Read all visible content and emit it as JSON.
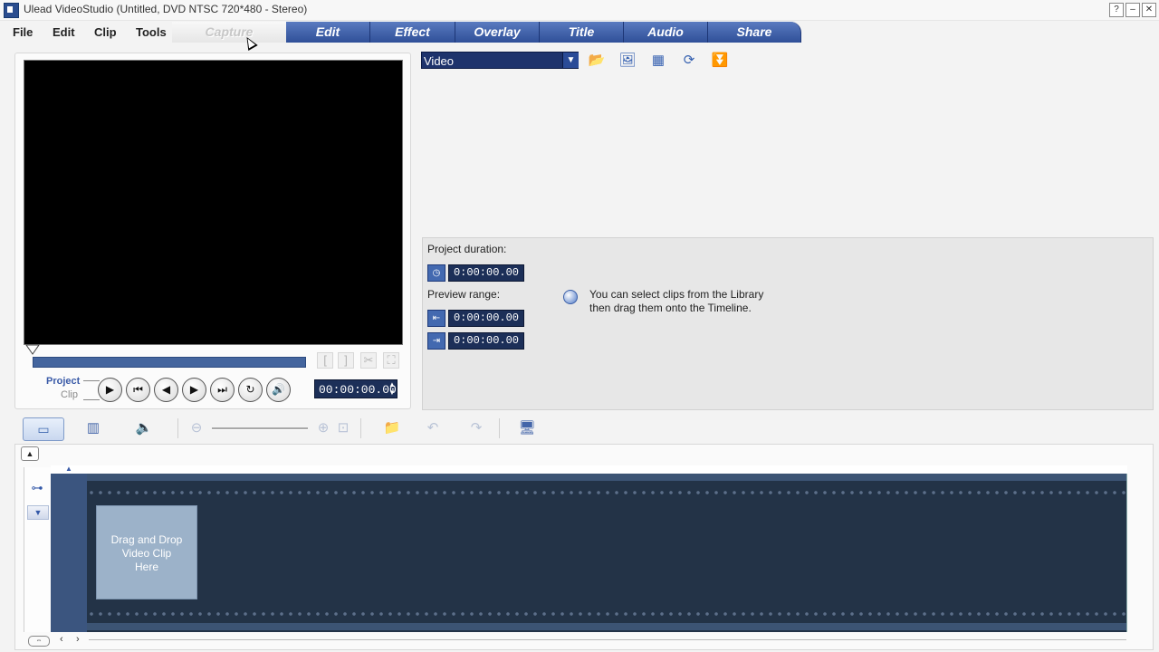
{
  "window": {
    "title": "Ulead VideoStudio (Untitled, DVD NTSC 720*480 - Stereo)",
    "help_label": "?",
    "minimize_label": "–",
    "close_label": "✕"
  },
  "menu": [
    "File",
    "Edit",
    "Clip",
    "Tools"
  ],
  "tabs": [
    {
      "label": "Capture",
      "active": true
    },
    {
      "label": "Edit",
      "active": false
    },
    {
      "label": "Effect",
      "active": false
    },
    {
      "label": "Overlay",
      "active": false
    },
    {
      "label": "Title",
      "active": false
    },
    {
      "label": "Audio",
      "active": false
    },
    {
      "label": "Share",
      "active": false
    }
  ],
  "preview": {
    "project_label": "Project",
    "clip_label": "Clip",
    "timecode": "00:00:00.00",
    "mark_in": "[",
    "mark_out": "]"
  },
  "library": {
    "selected": "Video"
  },
  "info": {
    "project_duration_label": "Project duration:",
    "project_duration": "0:00:00.00",
    "preview_range_label": "Preview range:",
    "range_start": "0:00:00.00",
    "range_end": "0:00:00.00",
    "tip": "You can select clips from the Library\nthen drag them onto the Timeline."
  },
  "timeline": {
    "drop_hint": "Drag and Drop\nVideo Clip\nHere"
  },
  "colors": {
    "tab_blue": "#2f4f98",
    "timecode_bg": "#1c2f58",
    "film_bg": "#233347"
  }
}
